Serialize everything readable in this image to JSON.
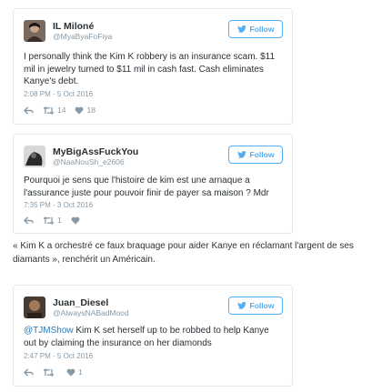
{
  "follow_label": "Follow",
  "colors": {
    "accent": "#55acee",
    "muted": "#8899a6",
    "link": "#2b7bb9",
    "border": "#e1e8ed"
  },
  "tweets": [
    {
      "name": "IL Miloné",
      "handle": "@MyaByaFoFiya",
      "text": "I personally think the Kim K robbery is an insurance scam. $11 mil in jewelry turned to $11 mil in cash fast. Cash eliminates Kanye's debt.",
      "date": "2:08 PM - 5 Oct 2016",
      "retweets": "14",
      "likes": "18"
    },
    {
      "name": "MyBigAssFuckYou",
      "handle": "@NaaNouSh_e2606",
      "text": "Pourquoi je sens que l'histoire de kim est une arnaque a l'assurance juste pour pouvoir finir de payer sa maison ? Mdr",
      "date": "7:35 PM - 3 Oct 2016",
      "retweets": "1",
      "likes": ""
    },
    {
      "name": "Juan_Diesel",
      "handle": "@AlwaysNABadMood",
      "mention": "@TJMShow",
      "text": " Kim K set herself up to be robbed to help Kanye out by claiming the insurance on her diamonds",
      "date": "2:47 PM - 5 Oct 2016",
      "retweets": "",
      "likes": "1"
    }
  ],
  "interstitial": "« Kim K a orchestré ce faux braquage pour aider Kanye en réclamant l'argent de ses diamants », renchérit un Américain."
}
